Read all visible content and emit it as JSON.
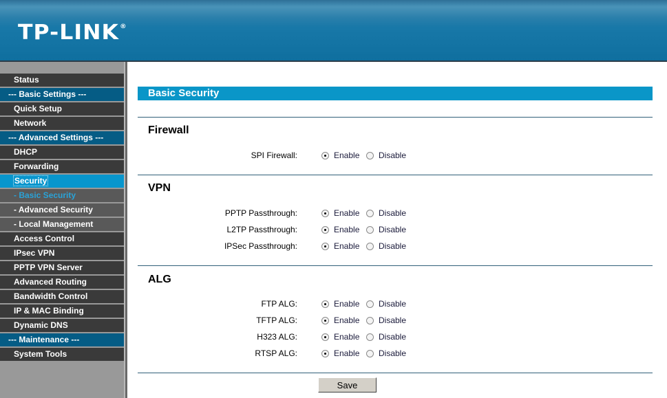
{
  "header": {
    "logo_text": "TP-LINK",
    "logo_mark": "®"
  },
  "sidebar": {
    "items": [
      {
        "label": "Status",
        "type": "item"
      },
      {
        "label": "--- Basic Settings ---",
        "type": "group"
      },
      {
        "label": "Quick Setup",
        "type": "item"
      },
      {
        "label": "Network",
        "type": "item"
      },
      {
        "label": "--- Advanced Settings ---",
        "type": "group"
      },
      {
        "label": "DHCP",
        "type": "item"
      },
      {
        "label": "Forwarding",
        "type": "item"
      },
      {
        "label": "Security",
        "type": "active"
      },
      {
        "label": "- Basic Security",
        "type": "sub-current"
      },
      {
        "label": "- Advanced Security",
        "type": "sub"
      },
      {
        "label": "- Local Management",
        "type": "sub"
      },
      {
        "label": "Access Control",
        "type": "item"
      },
      {
        "label": "IPsec VPN",
        "type": "item"
      },
      {
        "label": "PPTP VPN Server",
        "type": "item"
      },
      {
        "label": "Advanced Routing",
        "type": "item"
      },
      {
        "label": "Bandwidth Control",
        "type": "item"
      },
      {
        "label": "IP & MAC Binding",
        "type": "item"
      },
      {
        "label": "Dynamic DNS",
        "type": "item"
      },
      {
        "label": "--- Maintenance ---",
        "type": "group"
      },
      {
        "label": "System Tools",
        "type": "item"
      }
    ]
  },
  "main": {
    "page_title": "Basic Security",
    "enable_label": "Enable",
    "disable_label": "Disable",
    "sections": {
      "firewall": {
        "title": "Firewall",
        "rows": [
          {
            "label": "SPI Firewall:",
            "value": "Enable"
          }
        ]
      },
      "vpn": {
        "title": "VPN",
        "rows": [
          {
            "label": "PPTP Passthrough:",
            "value": "Enable"
          },
          {
            "label": "L2TP Passthrough:",
            "value": "Enable"
          },
          {
            "label": "IPSec Passthrough:",
            "value": "Enable"
          }
        ]
      },
      "alg": {
        "title": "ALG",
        "rows": [
          {
            "label": "FTP ALG:",
            "value": "Enable"
          },
          {
            "label": "TFTP ALG:",
            "value": "Enable"
          },
          {
            "label": "H323 ALG:",
            "value": "Enable"
          },
          {
            "label": "RTSP ALG:",
            "value": "Enable"
          }
        ]
      }
    },
    "save_label": "Save"
  },
  "colors": {
    "accent": "#0a96c8",
    "group_header": "#055c85",
    "nav_item": "#3a3a3a",
    "nav_sub": "#595959",
    "current_sub_text": "#29a3d8"
  }
}
